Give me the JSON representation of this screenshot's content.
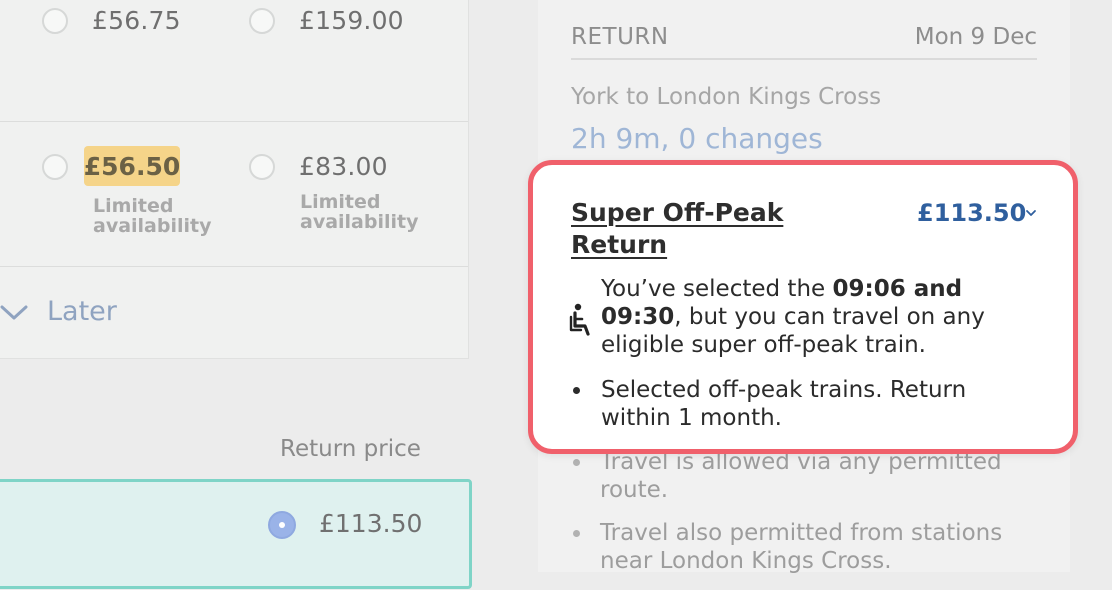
{
  "left": {
    "row1": {
      "price_a": "£56.75",
      "price_b": "£159.00"
    },
    "row2": {
      "price_a": "£56.50",
      "price_a_note": "Limited availability",
      "price_b": "£83.00",
      "price_b_note": "Limited availability"
    },
    "later_label": "Later",
    "return_price_label": "Return price",
    "selected_price": "£113.50"
  },
  "right": {
    "heading": "RETURN",
    "date": "Mon 9 Dec",
    "route": "York to London Kings Cross",
    "duration": "2h 9m, 0 changes",
    "fare": {
      "name": "Super Off-Peak Return",
      "price": "£113.50",
      "message_prefix": "You’ve selected the ",
      "message_times": "09:06 and 09:30",
      "message_suffix": ", but you can travel on any eligible super off-peak train.",
      "bullet": "Selected off-peak trains. Return within 1 month."
    },
    "more_bullets": [
      "Travel is allowed via any permitted route.",
      "Travel also permitted from stations near London Kings Cross."
    ]
  },
  "colors": {
    "highlight_border": "#f0606b",
    "fare_price": "#2f5f9e",
    "limited_badge": "#f5d489",
    "selected_card_bg": "#dff1ef",
    "selected_card_border": "#7fd4c7"
  },
  "icons": {
    "seat": "seat-icon",
    "later_chevron": "chevron-down-icon",
    "fare_chevron": "chevron-down-icon"
  }
}
